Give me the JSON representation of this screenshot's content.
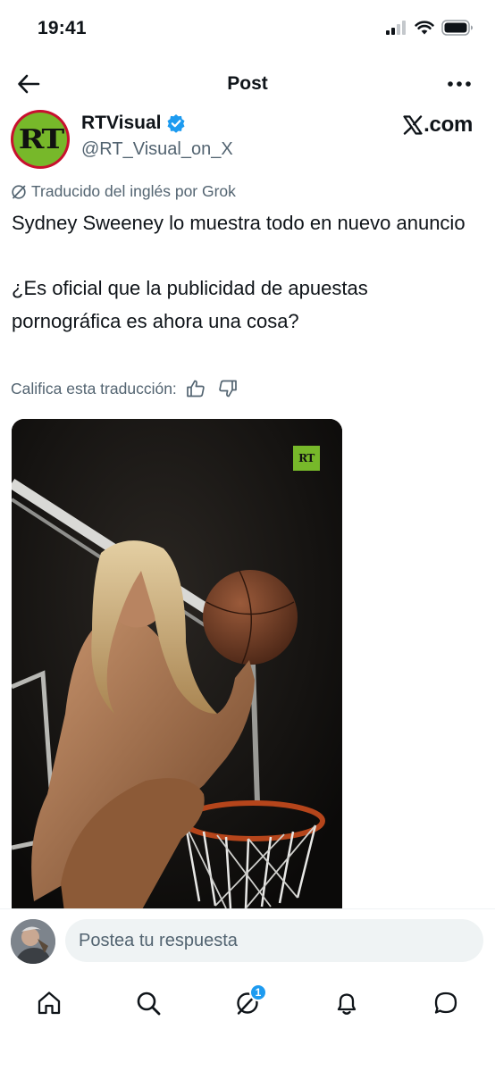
{
  "status_bar": {
    "time": "19:41",
    "icons": [
      "signal-icon",
      "wifi-icon",
      "battery-icon"
    ]
  },
  "nav": {
    "title": "Post",
    "back_icon": "arrow-left-icon",
    "more_icon": "more-horizontal-icon"
  },
  "author": {
    "name": "RTVisual",
    "handle": "@RT_Visual_on_X",
    "avatar_text": "RT",
    "verified": true,
    "affiliate_site": "X.com",
    "affiliate_site_suffix": ".com"
  },
  "translation": {
    "note": "Traducido del inglés por Grok",
    "rate_label": "Califica esta traducción:"
  },
  "post": {
    "line1": "Sydney Sweeney lo muestra todo en nuevo anuncio",
    "line2": "¿Es oficial que la publicidad de apuestas pornográfica es ahora una cosa?",
    "media_badge": "RT"
  },
  "reply": {
    "placeholder": "Postea tu respuesta"
  },
  "tabbar": {
    "items": [
      {
        "name": "home",
        "icon": "home-icon"
      },
      {
        "name": "search",
        "icon": "search-icon"
      },
      {
        "name": "grok",
        "icon": "grok-icon",
        "badge": "1"
      },
      {
        "name": "notifications",
        "icon": "bell-icon"
      },
      {
        "name": "messages",
        "icon": "chat-icon"
      }
    ]
  },
  "colors": {
    "text": "#0f1419",
    "secondary": "#536471",
    "verified": "#1d9bf0",
    "rt_green": "#77b82a",
    "input_bg": "#eff3f4"
  }
}
